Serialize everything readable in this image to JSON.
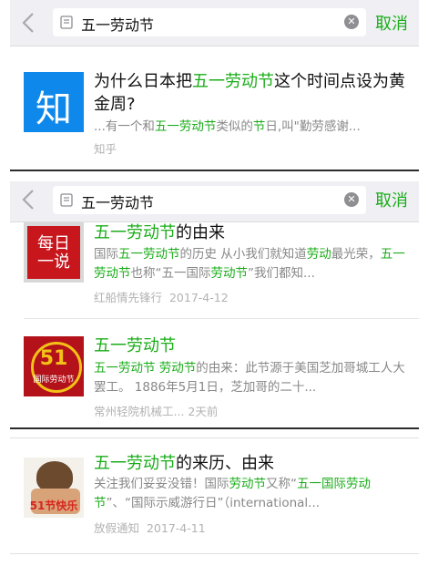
{
  "search": {
    "query": "五一劳动节",
    "cancel_label": "取消"
  },
  "colors": {
    "highlight": "#1aad19",
    "zhihu_blue": "#0f88eb"
  },
  "result_zhihu": {
    "logo_text": "知",
    "title": [
      {
        "t": "为什么日本把",
        "h": false
      },
      {
        "t": "五一劳动节",
        "h": true
      },
      {
        "t": "这个时间点设为黄金周?",
        "h": false
      }
    ],
    "snippet": [
      {
        "t": "...有一个和",
        "h": false
      },
      {
        "t": "五一劳动节",
        "h": true
      },
      {
        "t": "类似的",
        "h": false
      },
      {
        "t": "节",
        "h": true
      },
      {
        "t": "日,叫\"勤劳感谢...",
        "h": false
      }
    ],
    "source": "知乎"
  },
  "results": [
    {
      "thumb_icon": "hongchuan-logo-icon",
      "thumb_text": "每日一说",
      "title": [
        {
          "t": "五一劳动节",
          "h": true
        },
        {
          "t": "的由来",
          "h": false
        }
      ],
      "snippet": [
        {
          "t": "国际",
          "h": false
        },
        {
          "t": "五一劳动节",
          "h": true
        },
        {
          "t": "的历史 从小我们就知道",
          "h": false
        },
        {
          "t": "劳动",
          "h": true
        },
        {
          "t": "最光荣，",
          "h": false
        },
        {
          "t": "五一劳动节",
          "h": true
        },
        {
          "t": "也称“五一国际",
          "h": false
        },
        {
          "t": "劳动节",
          "h": true
        },
        {
          "t": "”我们都知...",
          "h": false
        }
      ],
      "source": "红船情先锋行",
      "date": "2017-4-12"
    },
    {
      "thumb_icon": "labor-day-51-badge-icon",
      "thumb_text": "51",
      "thumb_sub": "国际劳动节",
      "title": [
        {
          "t": "五一劳动节",
          "h": true
        }
      ],
      "snippet": [
        {
          "t": "五一劳动节 劳动节",
          "h": true
        },
        {
          "t": "的由来：此节源于美国芝加哥城工人大罢工。 1886年5月1日，芝加哥的二十...",
          "h": false
        }
      ],
      "source": "常州轻院机械工...",
      "date": "2天前"
    }
  ],
  "result_bottom": {
    "thumb_icon": "labor-day-poster-icon",
    "thumb_text": "51节快乐",
    "title": [
      {
        "t": "五一劳动节",
        "h": true
      },
      {
        "t": "的来历、由来",
        "h": false
      }
    ],
    "snippet": [
      {
        "t": "关注我们妥妥没错！国际",
        "h": false
      },
      {
        "t": "劳动节",
        "h": true
      },
      {
        "t": "又称“",
        "h": false
      },
      {
        "t": "五一国际劳动节",
        "h": true
      },
      {
        "t": "”、“国际示威游行日”（international...",
        "h": false
      }
    ],
    "source": "放假通知",
    "date": "2017-4-11"
  }
}
